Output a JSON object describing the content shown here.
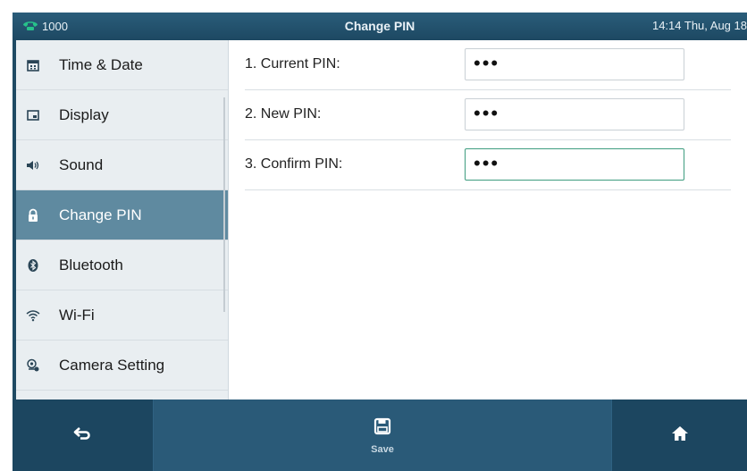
{
  "header": {
    "account": "1000",
    "title": "Change PIN",
    "datetime": "14:14 Thu, Aug 18"
  },
  "sidebar": {
    "items": [
      {
        "label": "Time & Date",
        "icon": "calendar-icon",
        "active": false
      },
      {
        "label": "Display",
        "icon": "display-icon",
        "active": false
      },
      {
        "label": "Sound",
        "icon": "speaker-icon",
        "active": false
      },
      {
        "label": "Change PIN",
        "icon": "lock-icon",
        "active": true
      },
      {
        "label": "Bluetooth",
        "icon": "bluetooth-icon",
        "active": false
      },
      {
        "label": "Wi-Fi",
        "icon": "wifi-icon",
        "active": false
      },
      {
        "label": "Camera Setting",
        "icon": "camera-icon",
        "active": false
      }
    ]
  },
  "form": {
    "current_pin": {
      "label": "1. Current PIN:",
      "value": "•••"
    },
    "new_pin": {
      "label": "2. New PIN:",
      "value": "•••"
    },
    "confirm_pin": {
      "label": "3. Confirm PIN:",
      "value": "•••"
    }
  },
  "footer": {
    "back_icon": "back-arrow-icon",
    "save_label": "Save",
    "save_icon": "save-icon",
    "home_icon": "home-icon"
  },
  "colors": {
    "header": "#1d4862",
    "active_item": "#5f8aa0",
    "focus_border": "#3e9c7f",
    "account_icon": "#27c28a"
  }
}
